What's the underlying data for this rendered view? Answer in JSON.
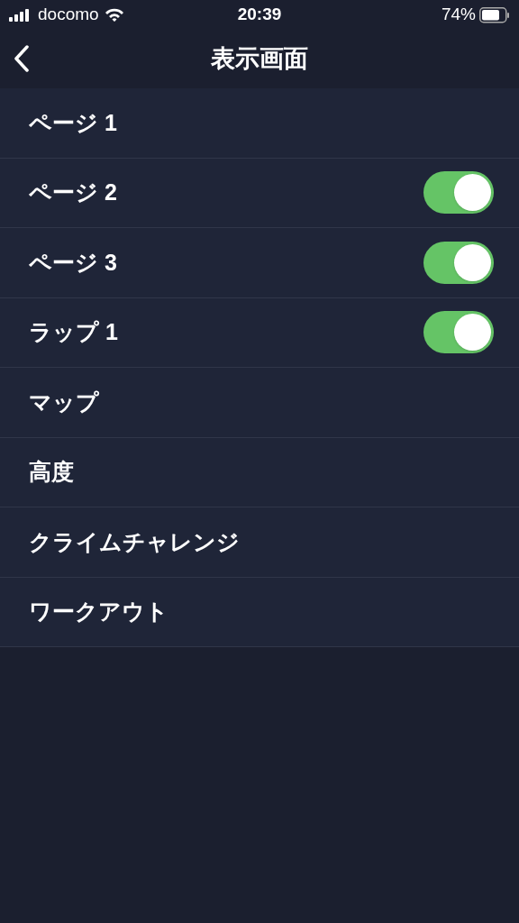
{
  "status_bar": {
    "carrier": "docomo",
    "time": "20:39",
    "battery": "74%"
  },
  "nav": {
    "title": "表示画面"
  },
  "rows": [
    {
      "label": "ページ 1",
      "kind": "plain"
    },
    {
      "label": "ページ 2",
      "kind": "toggle",
      "on": true
    },
    {
      "label": "ページ 3",
      "kind": "toggle",
      "on": true
    },
    {
      "label": "ラップ 1",
      "kind": "toggle",
      "on": true
    },
    {
      "label": "マップ",
      "kind": "plain"
    },
    {
      "label": "高度",
      "kind": "plain"
    },
    {
      "label": "クライムチャレンジ",
      "kind": "plain"
    },
    {
      "label": "ワークアウト",
      "kind": "plain"
    }
  ]
}
